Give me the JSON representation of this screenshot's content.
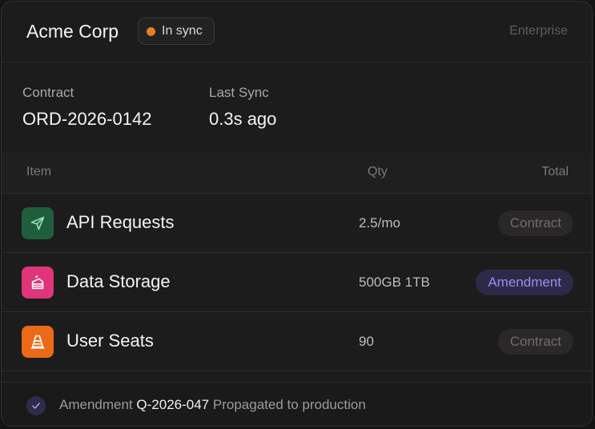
{
  "header": {
    "company": "Acme Corp",
    "status": "In sync",
    "plan": "Enterprise",
    "status_color": "#e67e22"
  },
  "meta": {
    "contract_label": "Contract",
    "contract_value": "ORD-2026-0142",
    "sync_label": "Last Sync",
    "sync_value": "0.3s ago"
  },
  "table": {
    "columns": {
      "item": "Item",
      "qty": "Qty",
      "total": "Total"
    },
    "rows": [
      {
        "name": "API Requests",
        "qty": "2.5/mo",
        "tag": "Contract",
        "icon": "send-icon",
        "icon_color": "#1f5e3d"
      },
      {
        "name": "Data Storage",
        "qty": "500GB 1TB",
        "tag": "Amendment",
        "icon": "cake-icon",
        "icon_color": "#e0357a"
      },
      {
        "name": "User Seats",
        "qty": "90",
        "tag": "Contract",
        "icon": "traffic-cone-icon",
        "icon_color": "#ec6a17"
      }
    ]
  },
  "footer": {
    "prefix": "Amendment",
    "reference": "Q-2026-047",
    "suffix": "Propagated to production"
  }
}
